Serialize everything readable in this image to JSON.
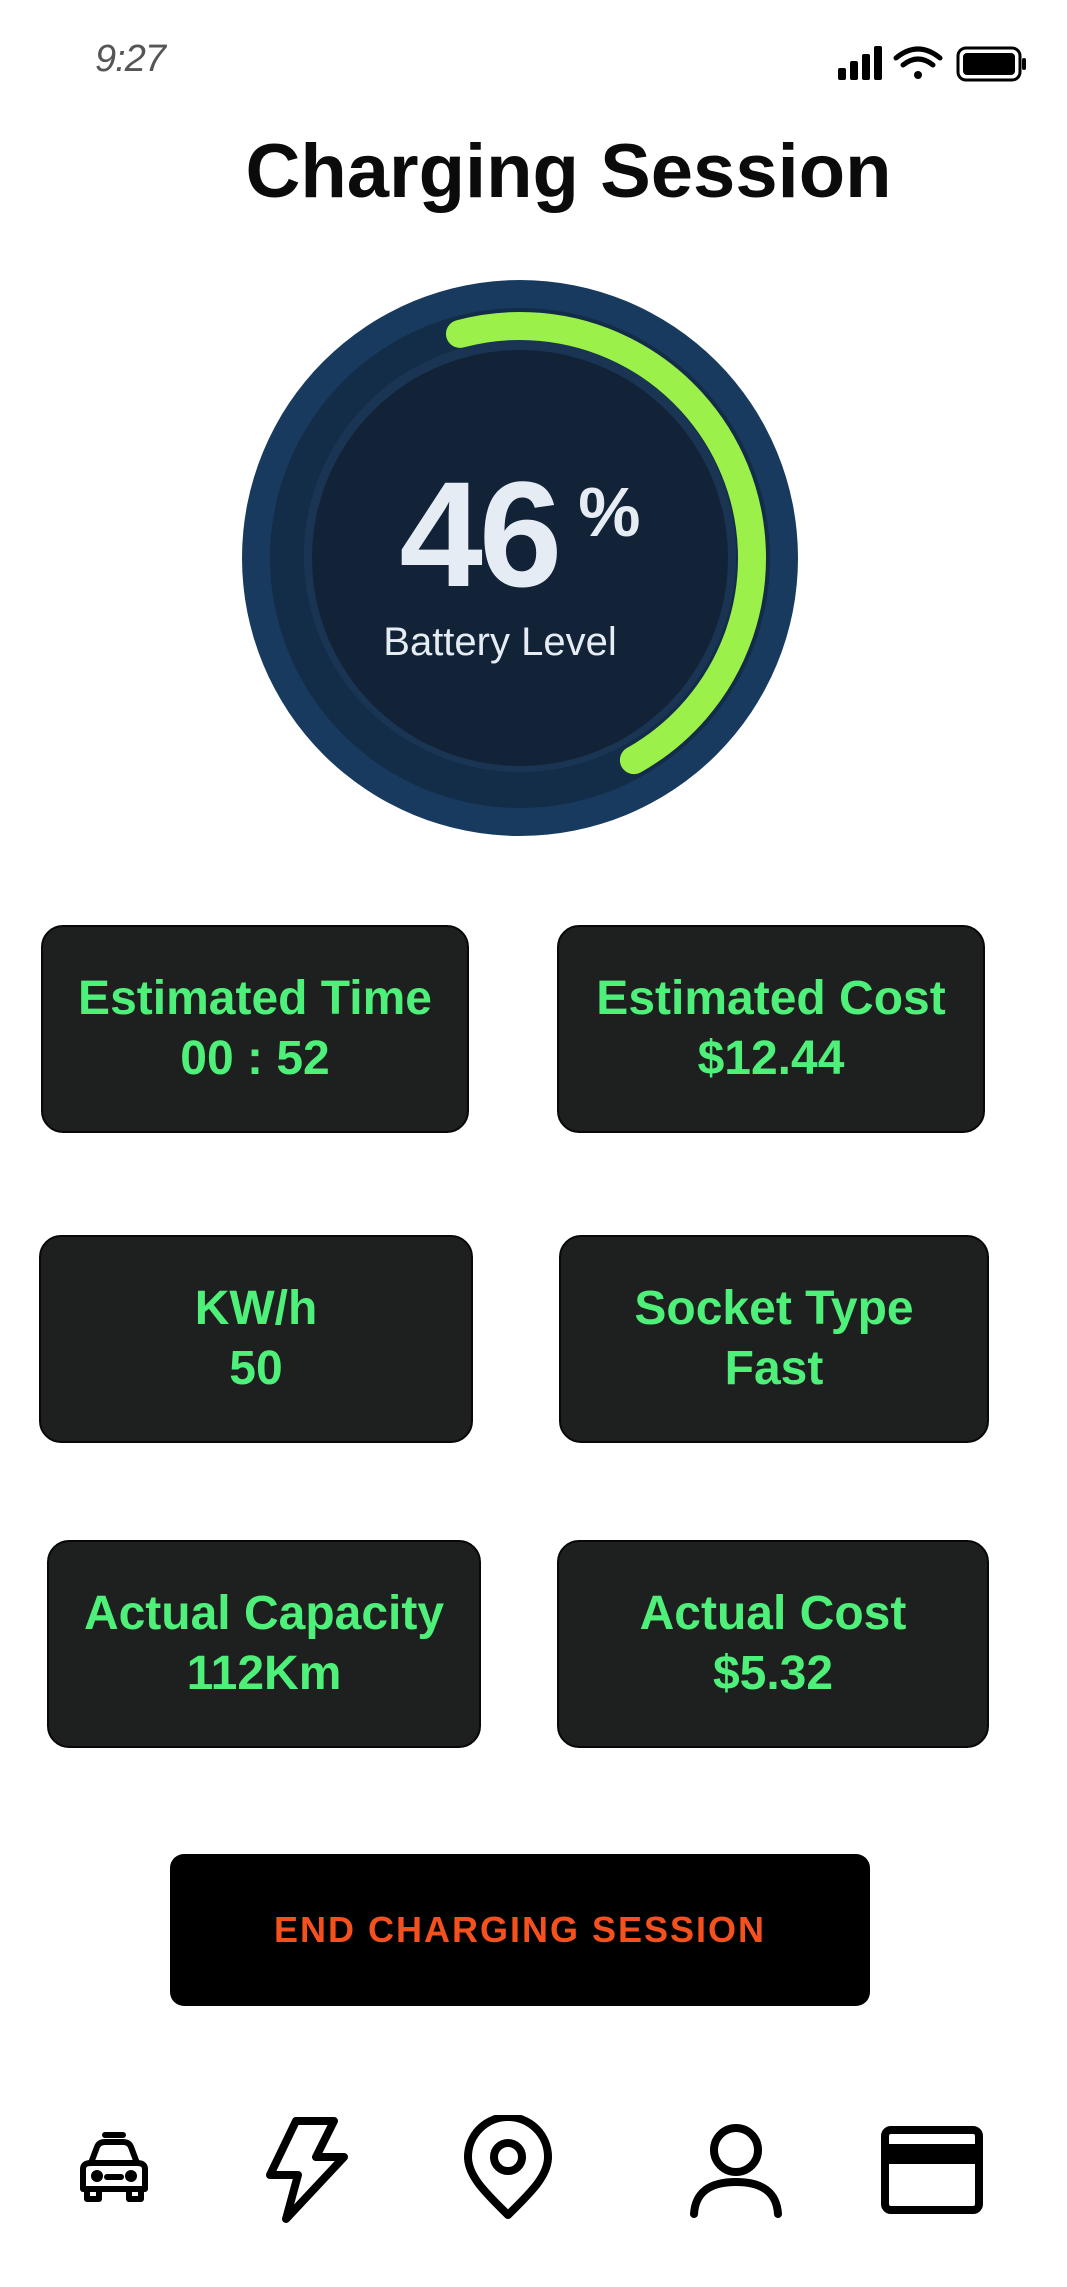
{
  "status_bar": {
    "time": "9:27",
    "icons": [
      "signal-icon",
      "wifi-icon",
      "battery-icon"
    ]
  },
  "header": {
    "title": "Charging Session"
  },
  "battery": {
    "level": 46,
    "value": "46",
    "unit": "%",
    "label": "Battery Level",
    "arc_color": "#9cf04a",
    "dial_color": "#122337"
  },
  "stats": {
    "estimated_time": {
      "label": "Estimated Time",
      "value": "00 : 52"
    },
    "estimated_cost": {
      "label": "Estimated Cost",
      "value": "$12.44"
    },
    "kwh": {
      "label": "KW/h",
      "value": "50"
    },
    "socket_type": {
      "label": "Socket Type",
      "value": "Fast"
    },
    "actual_capacity": {
      "label": "Actual Capacity",
      "value": "112Km"
    },
    "actual_cost": {
      "label": "Actual Cost",
      "value": "$5.32"
    }
  },
  "actions": {
    "end_session": "END CHARGING SESSION"
  },
  "bottom_nav": {
    "items": [
      "car-icon",
      "lightning-icon",
      "location-pin-icon",
      "user-icon",
      "card-icon"
    ]
  },
  "colors": {
    "card_background": "#1e1f1f",
    "card_text": "#4ef07a",
    "button_text": "#f4511e"
  }
}
